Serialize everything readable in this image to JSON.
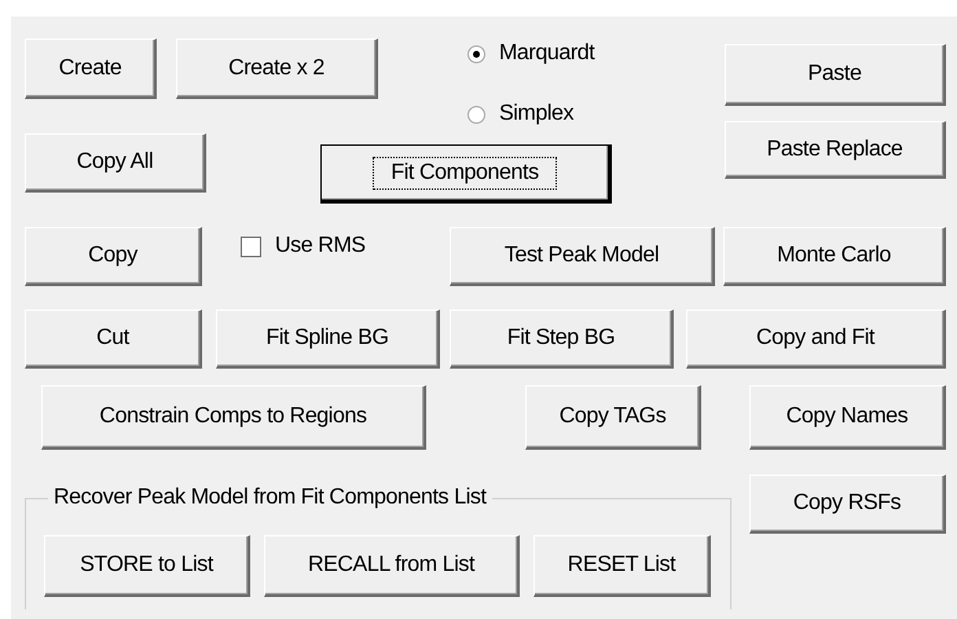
{
  "buttons": [
    {
      "label": "Create",
      "focused": false
    },
    {
      "label": "Create x 2",
      "focused": false
    },
    {
      "label": "Paste",
      "focused": false
    },
    {
      "label": "Paste Replace",
      "focused": false
    },
    {
      "label": "Copy All",
      "focused": false
    },
    {
      "label": "Fit Components",
      "focused": true
    },
    {
      "label": "Copy",
      "focused": false
    },
    {
      "label": "Test Peak Model",
      "focused": false
    },
    {
      "label": "Monte Carlo",
      "focused": false
    },
    {
      "label": "Cut",
      "focused": false
    },
    {
      "label": "Fit Spline BG",
      "focused": false
    },
    {
      "label": "Fit Step BG",
      "focused": false
    },
    {
      "label": "Copy and Fit",
      "focused": false
    },
    {
      "label": "Constrain Comps to Regions",
      "focused": false
    },
    {
      "label": "Copy TAGs",
      "focused": false
    },
    {
      "label": "Copy Names",
      "focused": false
    },
    {
      "label": "Copy RSFs",
      "focused": false
    }
  ],
  "fit_method": [
    {
      "label": "Marquardt",
      "selected": true
    },
    {
      "label": "Simplex",
      "selected": false
    }
  ],
  "use_rms": {
    "label": "Use RMS",
    "checked": false
  },
  "recover_group": {
    "title": "Recover Peak Model from Fit Components List",
    "buttons": [
      {
        "label": "STORE to List",
        "focused": false
      },
      {
        "label": "RECALL from List",
        "focused": false
      },
      {
        "label": "RESET List",
        "focused": false
      }
    ]
  }
}
